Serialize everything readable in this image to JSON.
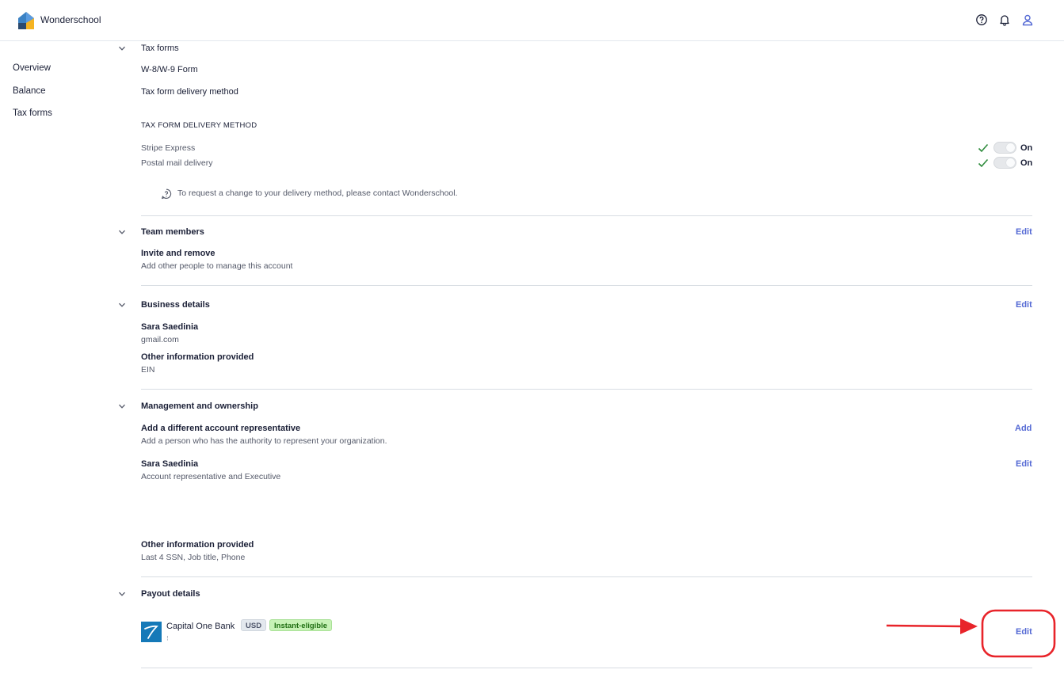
{
  "app": {
    "name": "Wonderschool"
  },
  "topbar": {
    "icons": [
      "help-icon",
      "bell-icon",
      "user-icon"
    ]
  },
  "sidebar": {
    "items": [
      {
        "label": "Overview"
      },
      {
        "label": "Balance"
      },
      {
        "label": "Tax forms"
      }
    ]
  },
  "tax_forms": {
    "title": "Tax forms",
    "w9": "W-8/W-9 Form",
    "delivery_label": "Tax form delivery method",
    "delivery_heading": "TAX FORM DELIVERY METHOD",
    "methods": [
      {
        "name": "Stripe Express",
        "state": "On"
      },
      {
        "name": "Postal mail delivery",
        "state": "On"
      }
    ],
    "note": "To request a change to your delivery method, please contact Wonderschool."
  },
  "team": {
    "title": "Team members",
    "edit": "Edit",
    "heading": "Invite and remove",
    "desc": "Add other people to manage this account"
  },
  "business": {
    "title": "Business details",
    "edit": "Edit",
    "name": "Sara Saedinia",
    "email": "gmail.com",
    "other_label": "Other information provided",
    "other_value": "EIN"
  },
  "management": {
    "title": "Management and ownership",
    "add_heading": "Add a different account representative",
    "add_desc": "Add a person who has the authority to represent your organization.",
    "add_link": "Add",
    "rep_name": "Sara Saedinia",
    "rep_role": "Account representative and Executive",
    "rep_edit": "Edit",
    "other_label": "Other information provided",
    "other_value": "Last 4 SSN, Job title, Phone"
  },
  "payout": {
    "title": "Payout details",
    "bank": "Capital One Bank",
    "currency_badge": "USD",
    "instant_badge": "Instant-eligible",
    "edit": "Edit"
  },
  "colors": {
    "link": "#5469d4",
    "annotation": "#e8242a",
    "check": "#2e8b3c",
    "instant_bg": "#c7f2b6",
    "instant_fg": "#1f6e12"
  }
}
